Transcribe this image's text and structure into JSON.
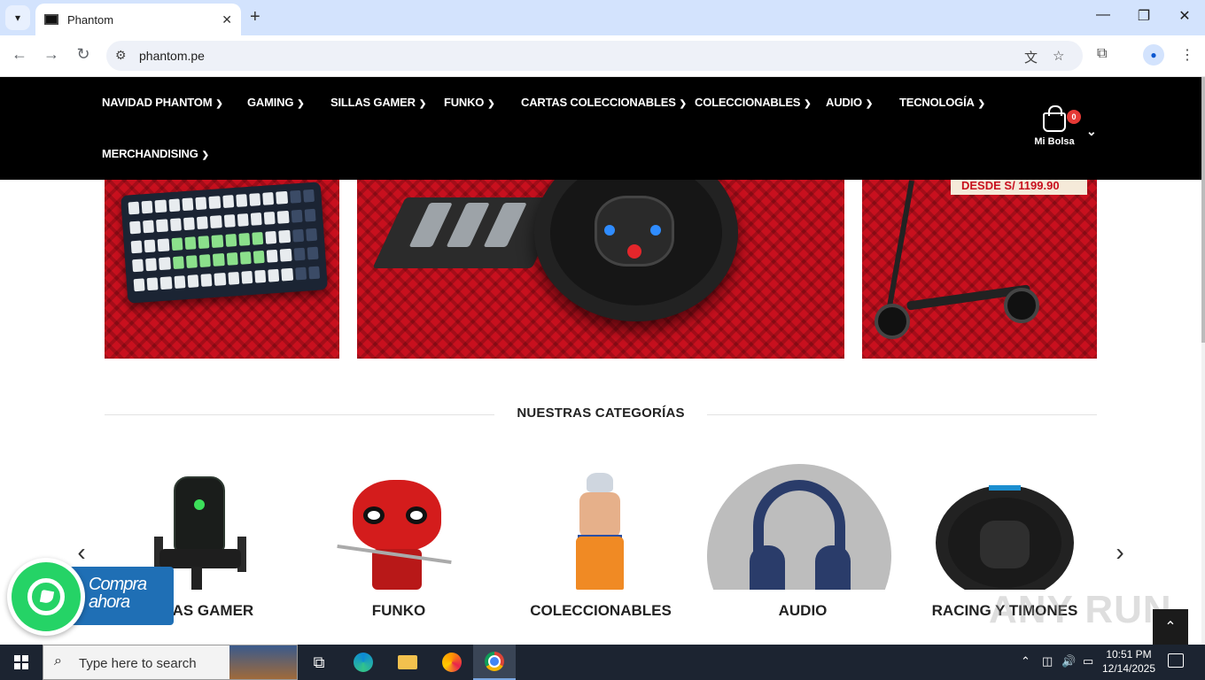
{
  "browser": {
    "tab_title": "Phantom",
    "url": "phantom.pe",
    "icons": [
      "tab-search-icon",
      "close-icon",
      "new-tab-icon",
      "minimize-icon",
      "restore-icon",
      "window-close-icon",
      "back-icon",
      "forward-icon",
      "reload-icon",
      "site-settings-icon",
      "translate-icon",
      "star-icon",
      "extensions-icon",
      "profile-icon",
      "menu-icon"
    ]
  },
  "nav": {
    "items": [
      {
        "label": "NAVIDAD PHANTOM"
      },
      {
        "label": "GAMING"
      },
      {
        "label": "SILLAS GAMER"
      },
      {
        "label": "FUNKO"
      },
      {
        "label": "CARTAS COLECCIONABLES"
      },
      {
        "label": "COLECCIONABLES"
      },
      {
        "label": "AUDIO"
      },
      {
        "label": "TECNOLOGÍA"
      },
      {
        "label": "MERCHANDISING"
      }
    ],
    "cart_label": "Mi Bolsa",
    "cart_count": "0"
  },
  "banners": {
    "price_text": "DESDE S/ 1199.90"
  },
  "categories": {
    "title": "NUESTRAS CATEGORÍAS",
    "items": [
      {
        "label": "SILLAS GAMER"
      },
      {
        "label": "FUNKO"
      },
      {
        "label": "COLECCIONABLES"
      },
      {
        "label": "AUDIO"
      },
      {
        "label": "RACING Y TIMONES"
      }
    ]
  },
  "whatsapp": {
    "cta": "Compra ahora"
  },
  "watermark": "ANY RUN",
  "taskbar": {
    "search_placeholder": "Type here to search",
    "time": "10:51 PM",
    "date": "12/14/2025"
  },
  "colors": {
    "header_bg": "#000000",
    "banner_red": "#c8101e",
    "whatsapp_green": "#25d366",
    "cta_blue": "#1f6fb5",
    "cart_badge": "#e53935"
  }
}
